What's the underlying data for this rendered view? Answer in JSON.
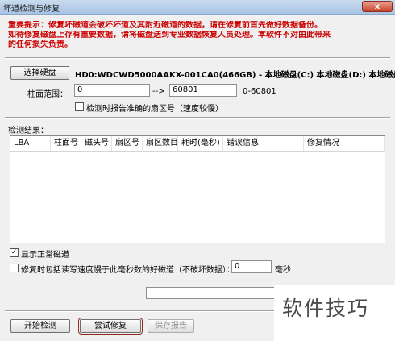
{
  "window": {
    "title": "坏道检测与修复",
    "close_label": "x"
  },
  "warning": {
    "line1": "重要提示：修复坏磁道会破坏坏道及其附近磁道的数据，请在修复前首先做好数据备份。",
    "line2": "如待修复磁盘上存有重要数据，请将磁盘送到专业数据恢复人员处理。本软件不对由此带来",
    "line3": "的任何损失负责。"
  },
  "disk": {
    "select_button": "选择硬盘",
    "info": "HD0:WDCWD5000AAKX-001CA0(466GB) - 本地磁盘(C:) 本地磁盘(D:) 本地磁盘"
  },
  "cylinder_range": {
    "label": "柱面范围：",
    "from_value": "0",
    "arrow": "-->",
    "to_value": "60801",
    "range_hint": "0-60801"
  },
  "options": {
    "report_sector_label": "检测时报告准确的扇区号（速度较慢）",
    "report_sector_checked": false,
    "show_normal_label": "显示正常磁道",
    "show_normal_checked": true,
    "repair_slow_label": "修复时包括读写速度慢于此毫秒数的好磁道（不破坏数据）：",
    "repair_slow_checked": false,
    "ms_value": "0",
    "ms_unit": "毫秒"
  },
  "results": {
    "label": "检测结果：",
    "columns": [
      "LBA",
      "柱面号",
      "磁头号",
      "扇区号",
      "扇区数目",
      "耗时(毫秒)",
      "错误信息",
      "修复情况"
    ]
  },
  "progress": {
    "value": 0
  },
  "buttons": {
    "start": "开始检测",
    "try_repair": "尝试修复",
    "save_report": "保存报告"
  },
  "watermark": {
    "text": "软件技巧"
  }
}
